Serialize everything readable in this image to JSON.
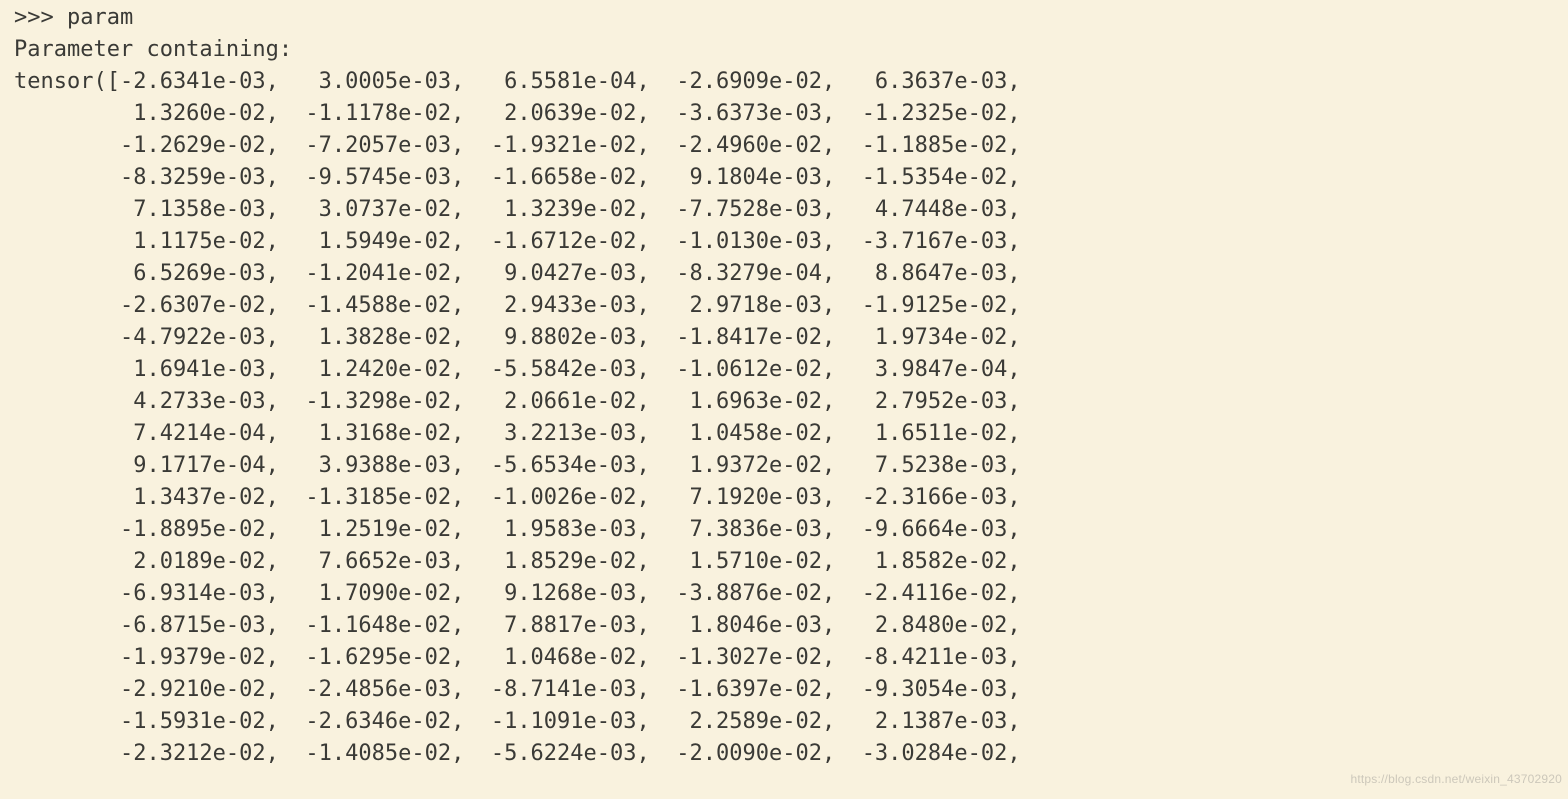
{
  "prompt": ">>> param",
  "header": "Parameter containing:",
  "tensor_prefix": "tensor([",
  "indent": "        ",
  "rows": [
    [
      "-2.6341e-03",
      " 3.0005e-03",
      " 6.5581e-04",
      "-2.6909e-02",
      " 6.3637e-03"
    ],
    [
      " 1.3260e-02",
      "-1.1178e-02",
      " 2.0639e-02",
      "-3.6373e-03",
      "-1.2325e-02"
    ],
    [
      "-1.2629e-02",
      "-7.2057e-03",
      "-1.9321e-02",
      "-2.4960e-02",
      "-1.1885e-02"
    ],
    [
      "-8.3259e-03",
      "-9.5745e-03",
      "-1.6658e-02",
      " 9.1804e-03",
      "-1.5354e-02"
    ],
    [
      " 7.1358e-03",
      " 3.0737e-02",
      " 1.3239e-02",
      "-7.7528e-03",
      " 4.7448e-03"
    ],
    [
      " 1.1175e-02",
      " 1.5949e-02",
      "-1.6712e-02",
      "-1.0130e-03",
      "-3.7167e-03"
    ],
    [
      " 6.5269e-03",
      "-1.2041e-02",
      " 9.0427e-03",
      "-8.3279e-04",
      " 8.8647e-03"
    ],
    [
      "-2.6307e-02",
      "-1.4588e-02",
      " 2.9433e-03",
      " 2.9718e-03",
      "-1.9125e-02"
    ],
    [
      "-4.7922e-03",
      " 1.3828e-02",
      " 9.8802e-03",
      "-1.8417e-02",
      " 1.9734e-02"
    ],
    [
      " 1.6941e-03",
      " 1.2420e-02",
      "-5.5842e-03",
      "-1.0612e-02",
      " 3.9847e-04"
    ],
    [
      " 4.2733e-03",
      "-1.3298e-02",
      " 2.0661e-02",
      " 1.6963e-02",
      " 2.7952e-03"
    ],
    [
      " 7.4214e-04",
      " 1.3168e-02",
      " 3.2213e-03",
      " 1.0458e-02",
      " 1.6511e-02"
    ],
    [
      " 9.1717e-04",
      " 3.9388e-03",
      "-5.6534e-03",
      " 1.9372e-02",
      " 7.5238e-03"
    ],
    [
      " 1.3437e-02",
      "-1.3185e-02",
      "-1.0026e-02",
      " 7.1920e-03",
      "-2.3166e-03"
    ],
    [
      "-1.8895e-02",
      " 1.2519e-02",
      " 1.9583e-03",
      " 7.3836e-03",
      "-9.6664e-03"
    ],
    [
      " 2.0189e-02",
      " 7.6652e-03",
      " 1.8529e-02",
      " 1.5710e-02",
      " 1.8582e-02"
    ],
    [
      "-6.9314e-03",
      " 1.7090e-02",
      " 9.1268e-03",
      "-3.8876e-02",
      "-2.4116e-02"
    ],
    [
      "-6.8715e-03",
      "-1.1648e-02",
      " 7.8817e-03",
      " 1.8046e-03",
      " 2.8480e-02"
    ],
    [
      "-1.9379e-02",
      "-1.6295e-02",
      " 1.0468e-02",
      "-1.3027e-02",
      "-8.4211e-03"
    ],
    [
      "-2.9210e-02",
      "-2.4856e-03",
      "-8.7141e-03",
      "-1.6397e-02",
      "-9.3054e-03"
    ],
    [
      "-1.5931e-02",
      "-2.6346e-02",
      "-1.1091e-03",
      " 2.2589e-02",
      " 2.1387e-03"
    ],
    [
      "-2.3212e-02",
      "-1.4085e-02",
      "-5.6224e-03",
      "-2.0090e-02",
      "-3.0284e-02"
    ]
  ],
  "watermark": "https://blog.csdn.net/weixin_43702920"
}
